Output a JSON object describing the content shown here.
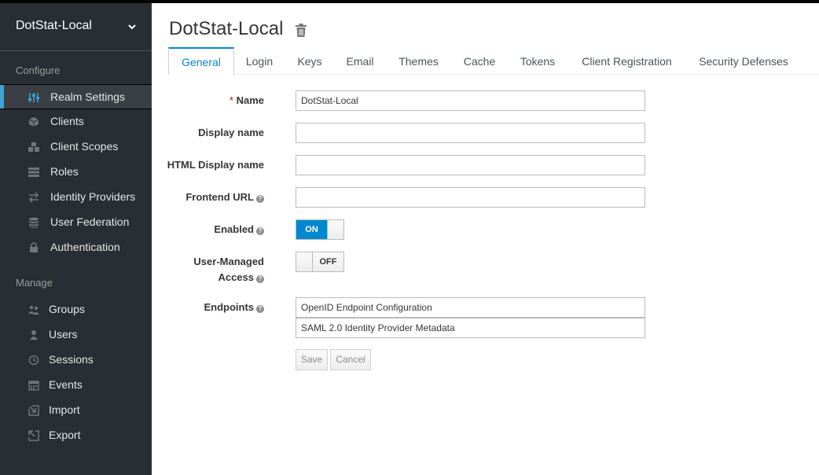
{
  "sidebar": {
    "realm": "DotStat-Local",
    "configure_label": "Configure",
    "manage_label": "Manage",
    "configure_items": [
      {
        "label": "Realm Settings",
        "icon": "sliders-icon"
      },
      {
        "label": "Clients",
        "icon": "cube-icon"
      },
      {
        "label": "Client Scopes",
        "icon": "cubes-icon"
      },
      {
        "label": "Roles",
        "icon": "list-icon"
      },
      {
        "label": "Identity Providers",
        "icon": "exchange-icon"
      },
      {
        "label": "User Federation",
        "icon": "database-icon"
      },
      {
        "label": "Authentication",
        "icon": "lock-icon"
      }
    ],
    "manage_items": [
      {
        "label": "Groups",
        "icon": "users-icon"
      },
      {
        "label": "Users",
        "icon": "user-icon"
      },
      {
        "label": "Sessions",
        "icon": "clock-icon"
      },
      {
        "label": "Events",
        "icon": "calendar-icon"
      },
      {
        "label": "Import",
        "icon": "import-icon"
      },
      {
        "label": "Export",
        "icon": "export-icon"
      }
    ]
  },
  "header": {
    "title": "DotStat-Local"
  },
  "tabs": [
    "General",
    "Login",
    "Keys",
    "Email",
    "Themes",
    "Cache",
    "Tokens",
    "Client Registration",
    "Security Defenses"
  ],
  "form": {
    "name_label": "Name",
    "name_value": "DotStat-Local",
    "display_name_label": "Display name",
    "display_name_value": "",
    "html_display_name_label": "HTML Display name",
    "html_display_name_value": "",
    "frontend_url_label": "Frontend URL",
    "frontend_url_value": "",
    "enabled_label": "Enabled",
    "enabled_state": "ON",
    "user_managed_label_1": "User-Managed",
    "user_managed_label_2": "Access",
    "user_managed_state": "OFF",
    "endpoints_label": "Endpoints",
    "endpoints": [
      "OpenID Endpoint Configuration",
      "SAML 2.0 Identity Provider Metadata"
    ],
    "save_label": "Save",
    "cancel_label": "Cancel"
  },
  "colors": {
    "accent": "#0088ce",
    "sidebar_bg": "#292e34",
    "active_marker": "#39a5dc"
  }
}
